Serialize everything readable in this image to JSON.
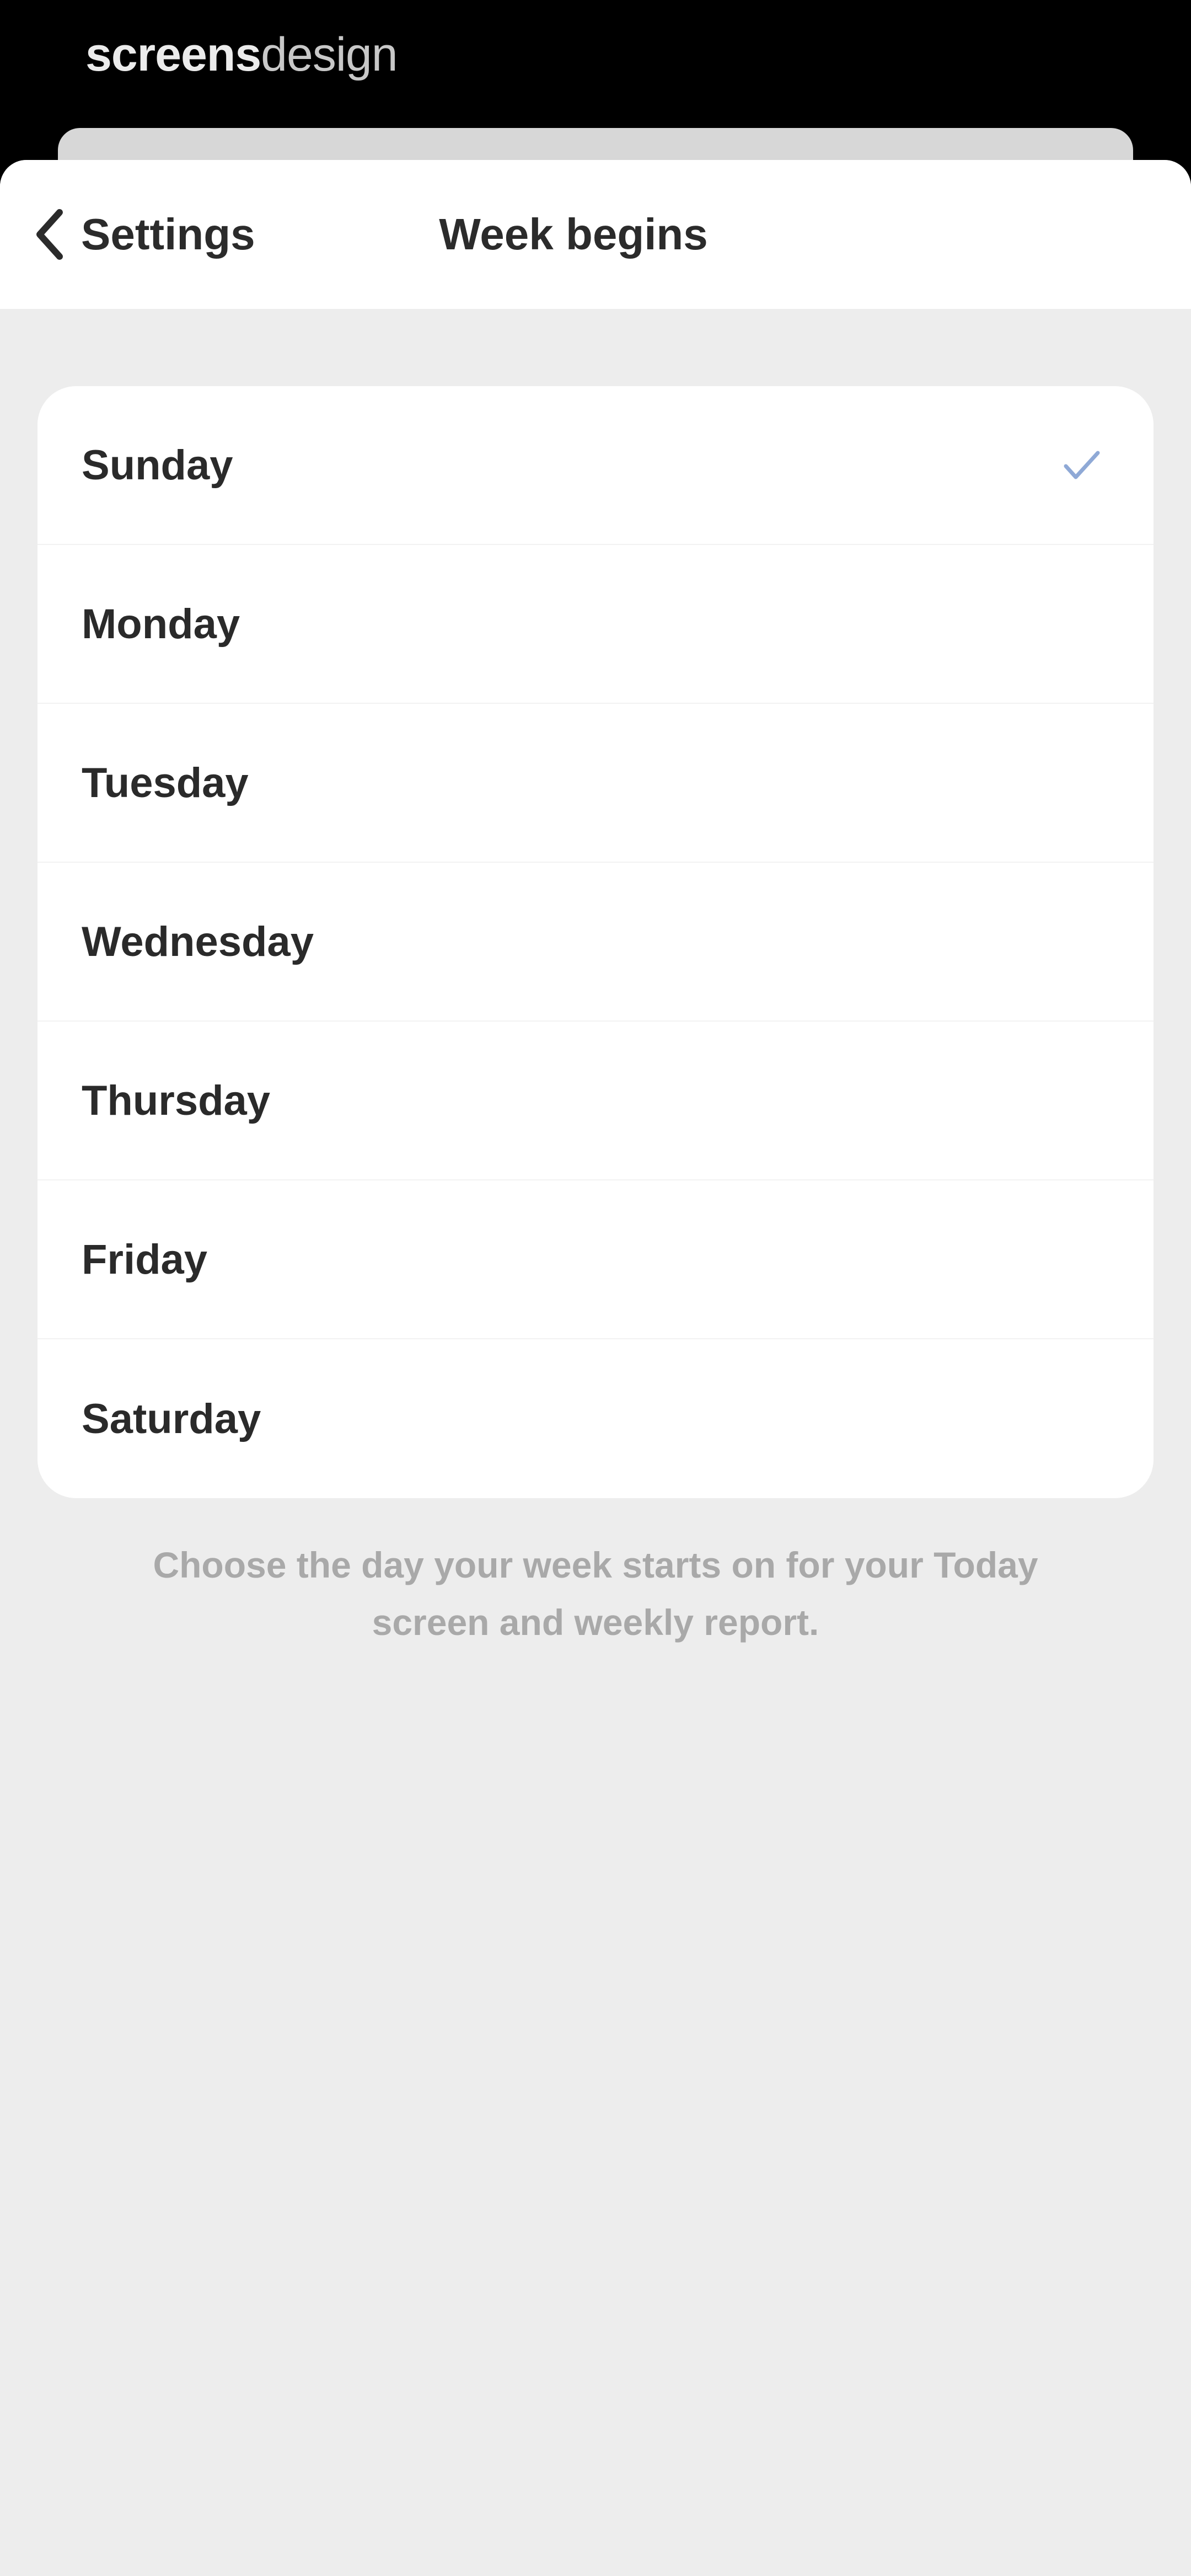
{
  "brand": {
    "part1": "screens",
    "part2": "design"
  },
  "nav": {
    "back_label": "Settings",
    "title": "Week begins"
  },
  "options": [
    {
      "label": "Sunday",
      "selected": true
    },
    {
      "label": "Monday",
      "selected": false
    },
    {
      "label": "Tuesday",
      "selected": false
    },
    {
      "label": "Wednesday",
      "selected": false
    },
    {
      "label": "Thursday",
      "selected": false
    },
    {
      "label": "Friday",
      "selected": false
    },
    {
      "label": "Saturday",
      "selected": false
    }
  ],
  "footnote": "Choose the day your week starts on for your Today screen and weekly report.",
  "colors": {
    "background": "#000000",
    "sheet": "#ededed",
    "card": "#ffffff",
    "checkmark": "#8fa9d6",
    "text_primary": "#2a2a2a",
    "text_secondary": "#a9a9a9"
  },
  "icons": {
    "back": "chevron-left-icon",
    "selected": "checkmark-icon"
  }
}
